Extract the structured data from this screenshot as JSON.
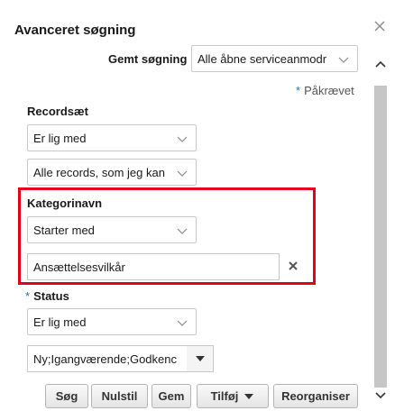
{
  "dialog": {
    "title": "Avanceret søgning",
    "close_icon": "close-icon"
  },
  "saved_search": {
    "label": "Gemt søgning",
    "value": "Alle åbne serviceanmodr"
  },
  "required_note": {
    "star": "*",
    "text": "Påkrævet"
  },
  "recordset": {
    "label": "Recordsæt",
    "operator": "Er lig med",
    "value": "Alle records, som jeg kan"
  },
  "category_name": {
    "label": "Kategorinavn",
    "operator": "Starter med",
    "value": "Ansættelsesvilkår",
    "clear_icon": "clear-x-icon"
  },
  "status": {
    "required_star": "*",
    "label": "Status",
    "operator": "Er lig med",
    "value": "Ny;Igangværende;Godkenc"
  },
  "buttons": {
    "search": "Søg",
    "reset": "Nulstil",
    "save": "Gem",
    "add": "Tilføj",
    "add_icon": "caret-down-icon",
    "reorder": "Reorganiser"
  },
  "colors": {
    "highlight": "#e3001b",
    "required": "#1d71b8"
  }
}
